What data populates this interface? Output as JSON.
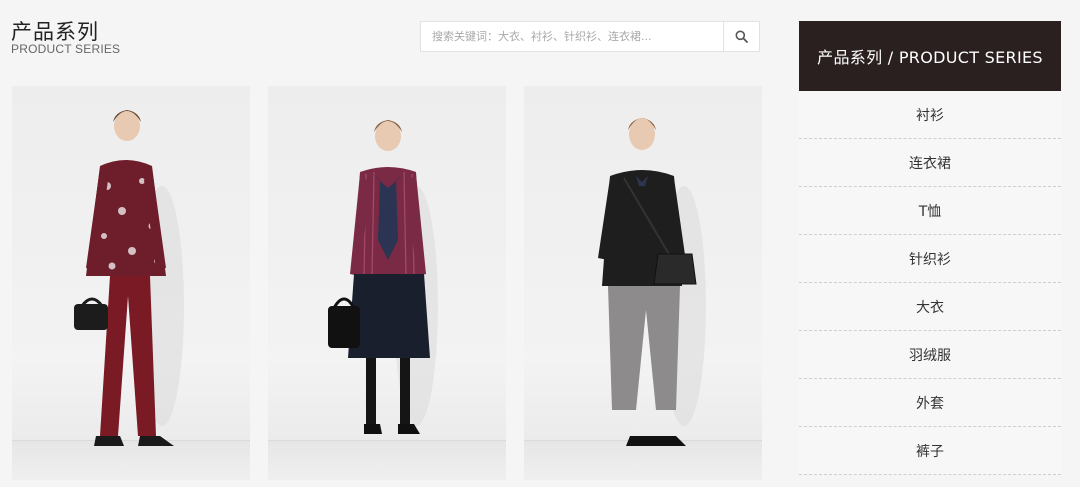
{
  "header": {
    "title": "产品系列",
    "subtitle": "PRODUCT SERIES"
  },
  "search": {
    "placeholder": "搜索关键词：大衣、衬衫、针织衫、连衣裙...",
    "button_icon": "search-icon"
  },
  "products": [
    {
      "name": "floral-blouse-outfit"
    },
    {
      "name": "striped-shirt-outfit"
    },
    {
      "name": "black-jacket-outfit"
    }
  ],
  "sidebar": {
    "title": "产品系列 / PRODUCT SERIES",
    "items": [
      {
        "label": "衬衫"
      },
      {
        "label": "连衣裙"
      },
      {
        "label": "T恤"
      },
      {
        "label": "针织衫"
      },
      {
        "label": "大衣"
      },
      {
        "label": "羽绒服"
      },
      {
        "label": "外套"
      },
      {
        "label": "裤子"
      }
    ]
  },
  "colors": {
    "sidebar_header": "#2a2020",
    "background": "#f5f5f5"
  }
}
